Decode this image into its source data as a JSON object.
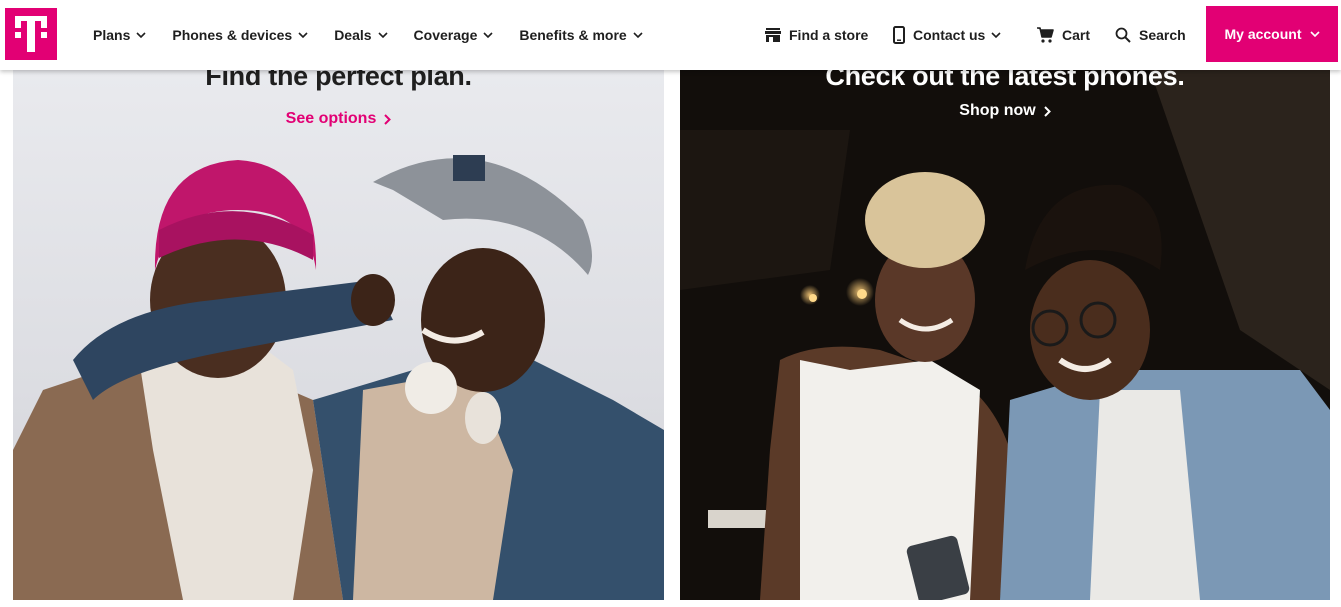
{
  "brand": {
    "logo_letter": "T",
    "accent": "#e20074"
  },
  "nav": {
    "items": [
      {
        "label": "Plans"
      },
      {
        "label": "Phones & devices"
      },
      {
        "label": "Deals"
      },
      {
        "label": "Coverage"
      },
      {
        "label": "Benefits & more"
      }
    ],
    "find_store": "Find a store",
    "contact_us": "Contact us",
    "cart": "Cart",
    "search": "Search",
    "my_account": "My account"
  },
  "promos": [
    {
      "title": "Find the perfect plan.",
      "cta": "See options"
    },
    {
      "title": "Check out the latest phones.",
      "cta": "Shop now"
    }
  ],
  "icons": [
    "store-icon",
    "phone-icon",
    "cart-icon",
    "search-icon",
    "chevron-down-icon",
    "chevron-right-icon"
  ]
}
